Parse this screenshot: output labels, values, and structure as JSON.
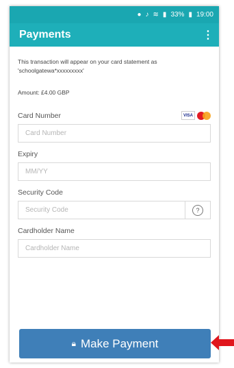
{
  "status_bar": {
    "icons": [
      "location-icon",
      "sound-icon",
      "wifi-icon",
      "signal-icon",
      "battery-icon"
    ],
    "battery": "33%",
    "time": "19:00"
  },
  "app_bar": {
    "title": "Payments",
    "menu_icon": "overflow-menu-icon"
  },
  "notice": "This transaction will appear on your card statement as 'schoolgatewa*xxxxxxxxx'",
  "amount": "Amount: £4.00 GBP",
  "fields": {
    "card_number": {
      "label": "Card Number",
      "placeholder": "Card Number",
      "value": ""
    },
    "expiry": {
      "label": "Expiry",
      "placeholder": "MM/YY",
      "value": ""
    },
    "security_code": {
      "label": "Security Code",
      "placeholder": "Security Code",
      "value": "",
      "help": "?"
    },
    "cardholder_name": {
      "label": "Cardholder Name",
      "placeholder": "Cardholder Name",
      "value": ""
    }
  },
  "card_logos": {
    "visa": "VISA",
    "mastercard": "mastercard-logo"
  },
  "pay_button": {
    "label": "Make Payment",
    "icon": "lock-icon"
  },
  "colors": {
    "header": "#1eafb9",
    "button": "#3f7fb8",
    "arrow": "#e0161d"
  }
}
